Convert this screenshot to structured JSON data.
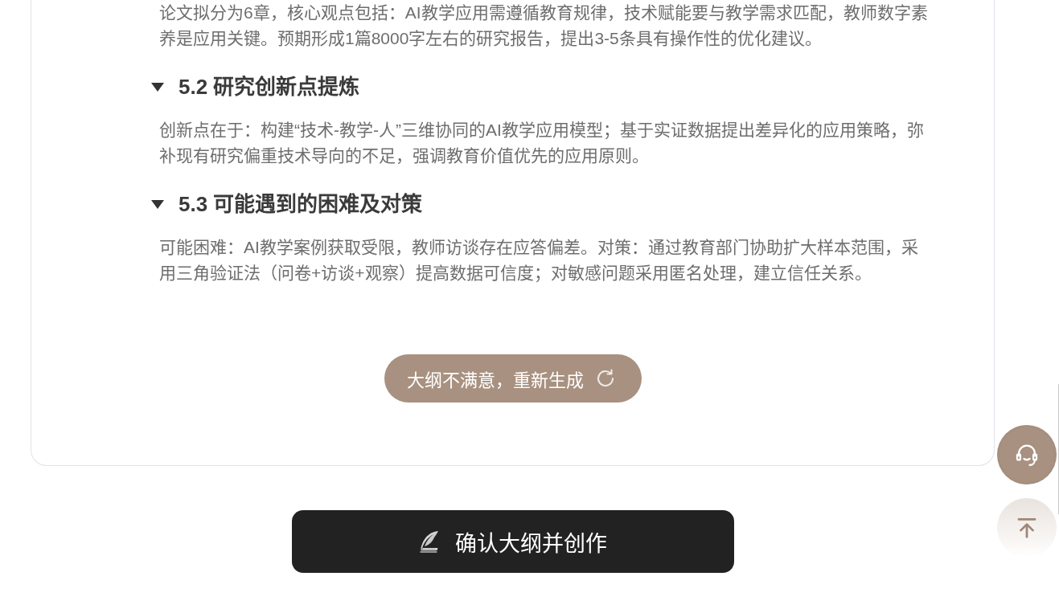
{
  "outline": {
    "sections": [
      {
        "paragraph": "论文拟分为6章，核心观点包括：AI教学应用需遵循教育规律，技术赋能要与教学需求匹配，教师数字素养是应用关键。预期形成1篇8000字左右的研究报告，提出3-5条具有操作性的优化建议。"
      },
      {
        "heading": "5.2 研究创新点提炼",
        "expanded": true,
        "paragraph": "创新点在于：构建“技术-教学-人”三维协同的AI教学应用模型；基于实证数据提出差异化的应用策略，弥补现有研究偏重技术导向的不足，强调教育价值优先的应用原则。"
      },
      {
        "heading": "5.3 可能遇到的困难及对策",
        "expanded": true,
        "paragraph": "可能困难：AI教学案例获取受限，教师访谈存在应答偏差。对策：通过教育部门协助扩大样本范围，采用三角验证法（问卷+访谈+观察）提高数据可信度；对敏感问题采用匿名处理，建立信任关系。"
      }
    ],
    "regenerate_button": {
      "label": "大纲不满意，重新生成"
    }
  },
  "confirm_button": {
    "label": "确认大纲并创作"
  },
  "side_buttons": [
    {
      "kind": "support"
    },
    {
      "kind": "back_to_top"
    }
  ]
}
